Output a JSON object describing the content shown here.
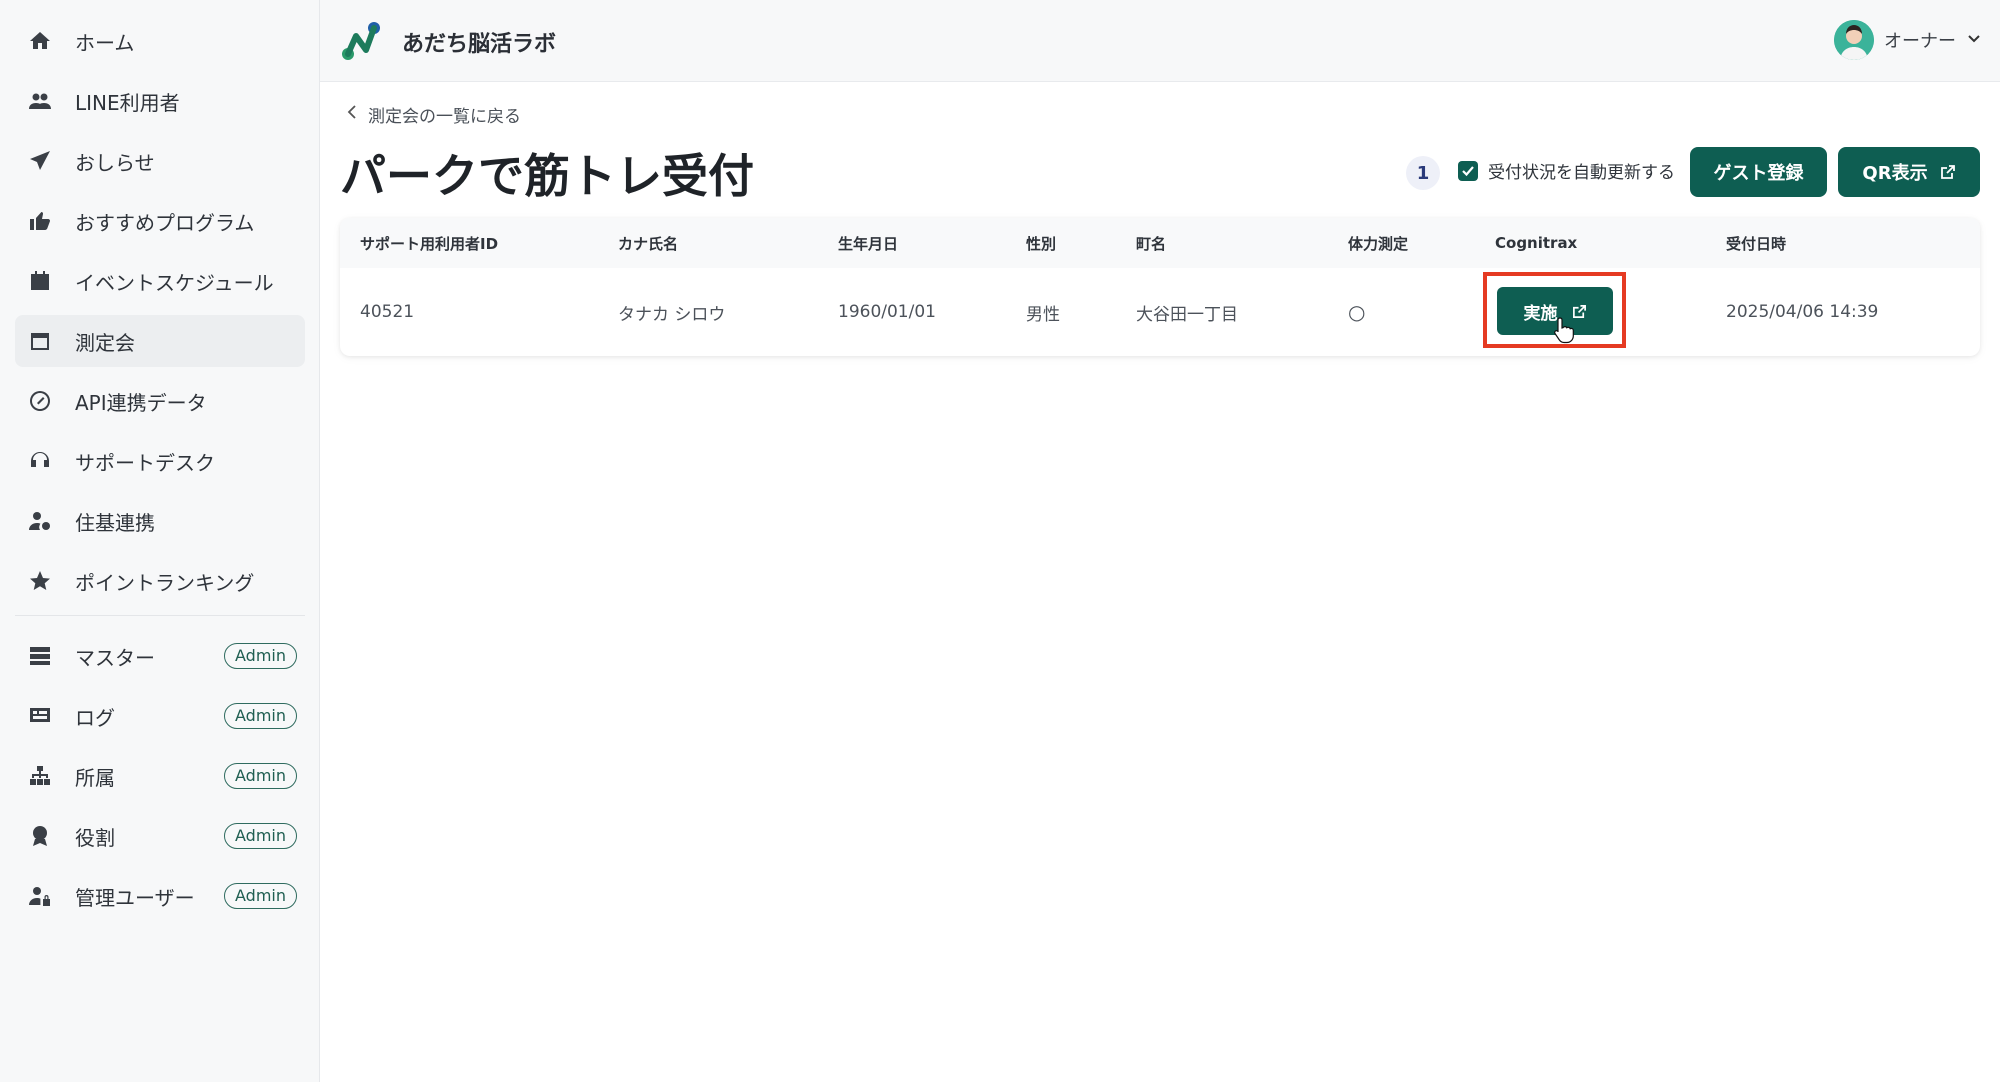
{
  "sidebar": {
    "items": [
      {
        "label": "ホーム",
        "icon": "home-icon"
      },
      {
        "label": "LINE利用者",
        "icon": "users-icon"
      },
      {
        "label": "おしらせ",
        "icon": "send-icon"
      },
      {
        "label": "おすすめプログラム",
        "icon": "thumbs-up-icon"
      },
      {
        "label": "イベントスケジュール",
        "icon": "calendar-icon"
      },
      {
        "label": "測定会",
        "icon": "calendar-outline-icon",
        "active": true
      },
      {
        "label": "API連携データ",
        "icon": "api-icon"
      },
      {
        "label": "サポートデスク",
        "icon": "headset-icon"
      },
      {
        "label": "住基連携",
        "icon": "user-cog-icon"
      },
      {
        "label": "ポイントランキング",
        "icon": "star-icon"
      }
    ],
    "admin_items": [
      {
        "label": "マスター",
        "icon": "database-icon",
        "badge": "Admin"
      },
      {
        "label": "ログ",
        "icon": "log-icon",
        "badge": "Admin"
      },
      {
        "label": "所属",
        "icon": "org-chart-icon",
        "badge": "Admin"
      },
      {
        "label": "役割",
        "icon": "award-icon",
        "badge": "Admin"
      },
      {
        "label": "管理ユーザー",
        "icon": "user-lock-icon",
        "badge": "Admin"
      }
    ]
  },
  "header": {
    "brand": "あだち脳活ラボ",
    "user_name": "オーナー"
  },
  "main": {
    "back_label": "測定会の一覧に戻る",
    "title": "パークで筋トレ受付",
    "count": "1",
    "auto_update_label": "受付状況を自動更新する",
    "auto_update_checked": true,
    "guest_button": "ゲスト登録",
    "qr_button": "QR表示",
    "table": {
      "headers": [
        "サポート用利用者ID",
        "カナ氏名",
        "生年月日",
        "性別",
        "町名",
        "体力測定",
        "Cognitrax",
        "受付日時"
      ],
      "rows": [
        {
          "id": "40521",
          "kana": "タナカ シロウ",
          "birth": "1960/01/01",
          "gender": "男性",
          "town": "大谷田一丁目",
          "fitness": "○",
          "cognitrax_button": "実施",
          "received": "2025/04/06 14:39"
        }
      ]
    }
  },
  "colors": {
    "primary": "#0e5e52",
    "highlight": "#e53a22"
  }
}
